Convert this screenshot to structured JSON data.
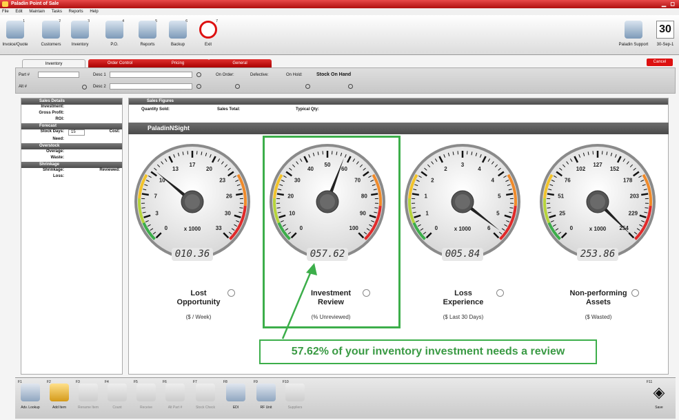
{
  "window": {
    "title": "Paladin Point of Sale"
  },
  "menu": [
    "File",
    "Edit",
    "Maintain",
    "Tasks",
    "Reports",
    "Help"
  ],
  "toolbar": {
    "buttons": [
      {
        "label": "Invoice/Quote",
        "count": "1"
      },
      {
        "label": "Customers",
        "count": "2"
      },
      {
        "label": "Inventory",
        "count": "3"
      },
      {
        "label": "P.O.",
        "count": "4"
      },
      {
        "label": "Reports",
        "count": "5"
      },
      {
        "label": "Backup",
        "count": "6"
      },
      {
        "label": "Exit",
        "count": "7"
      }
    ],
    "support_label": "Paladin Support",
    "calendar_day": "30",
    "calendar_date": "30-Sep-1"
  },
  "tabs": [
    "Inventory",
    "Order Control",
    "Pricing",
    "General"
  ],
  "cancel_label": "Cancel",
  "partbar": {
    "part_label": "Part #",
    "alt_label": "Alt #",
    "desc1_label": "Desc 1",
    "desc2_label": "Desc 2",
    "on_order_label": "On Order:",
    "defective_label": "Defective:",
    "on_hold_label": "On Hold:",
    "stock_on_hand_label": "Stock On Hand"
  },
  "left_panel": {
    "sections": [
      {
        "number": "1",
        "title": "Sales Details",
        "rows": [
          "Investment:",
          "Gross Profit:",
          "ROI:"
        ]
      },
      {
        "number": "2",
        "title": "Forecast",
        "rows": [
          "Stock Days:",
          "Need:"
        ],
        "stock_days_value": "15",
        "cost_label": "Cost:"
      },
      {
        "number": "3",
        "title": "Overstock",
        "rows": [
          "Overage:",
          "Waste:"
        ]
      },
      {
        "number": "4",
        "title": "Shrinkage",
        "rows": [
          "Shrinkage:",
          "Loss:"
        ],
        "reviewed_label": "Reviewed:"
      }
    ]
  },
  "sales_figures": {
    "number": "1",
    "title": "Sales Figures",
    "quantity_sold_label": "Quantity Sold:",
    "sales_total_label": "Sales Total:",
    "typical_qty_label": "Typical Qty:"
  },
  "nsight": {
    "number": "2",
    "title": "PaladinNSight"
  },
  "gauges": [
    {
      "title_line1": "Lost",
      "title_line2": "Opportunity",
      "subtitle": "($ / Week)",
      "reading": "010.36",
      "multiplier": "x 1000",
      "ticks": [
        "0",
        "3",
        "7",
        "10",
        "13",
        "17",
        "20",
        "23",
        "26",
        "30",
        "33"
      ],
      "value": 10.36,
      "max": 33
    },
    {
      "title_line1": "Investment",
      "title_line2": "Review",
      "subtitle": "(% Unreviewed)",
      "reading": "057.62",
      "multiplier": "",
      "ticks": [
        "0",
        "10",
        "20",
        "30",
        "40",
        "50",
        "60",
        "70",
        "80",
        "90",
        "100"
      ],
      "value": 57.62,
      "max": 100
    },
    {
      "title_line1": "Loss",
      "title_line2": "Experience",
      "subtitle": "($ Last 30 Days)",
      "reading": "005.84",
      "multiplier": "x 1000",
      "ticks": [
        "0",
        "1",
        "1",
        "2",
        "2",
        "3",
        "4",
        "4",
        "5",
        "5",
        "6"
      ],
      "value": 5.84,
      "max": 6
    },
    {
      "title_line1": "Non-performing",
      "title_line2": "Assets",
      "subtitle": "($ Wasted)",
      "reading": "253.86",
      "multiplier": "x 1000",
      "ticks": [
        "0",
        "25",
        "51",
        "76",
        "102",
        "127",
        "152",
        "178",
        "203",
        "229",
        "254"
      ],
      "value": 253.86,
      "max": 254
    }
  ],
  "callout": "57.62% of your inventory investment needs a review",
  "bottom_bar": {
    "buttons": [
      {
        "fkey": "F1",
        "label": "Adv. Lookup",
        "enabled": true
      },
      {
        "fkey": "F2",
        "label": "Add Item",
        "enabled": true
      },
      {
        "fkey": "F3",
        "label": "Rename Item",
        "enabled": false
      },
      {
        "fkey": "F4",
        "label": "Count",
        "enabled": false
      },
      {
        "fkey": "F5",
        "label": "Receive",
        "enabled": false
      },
      {
        "fkey": "F6",
        "label": "Alt Part #",
        "enabled": false
      },
      {
        "fkey": "F7",
        "label": "Stock Check",
        "enabled": false
      },
      {
        "fkey": "F8",
        "label": "EDI",
        "enabled": true
      },
      {
        "fkey": "F9",
        "label": "RF Unit",
        "enabled": true
      },
      {
        "fkey": "F10",
        "label": "Suppliers",
        "enabled": false
      }
    ],
    "save": {
      "fkey": "F11",
      "label": "Save"
    }
  },
  "colors": {
    "accent_red": "#cc1111",
    "highlight_green": "#3cae4a"
  }
}
